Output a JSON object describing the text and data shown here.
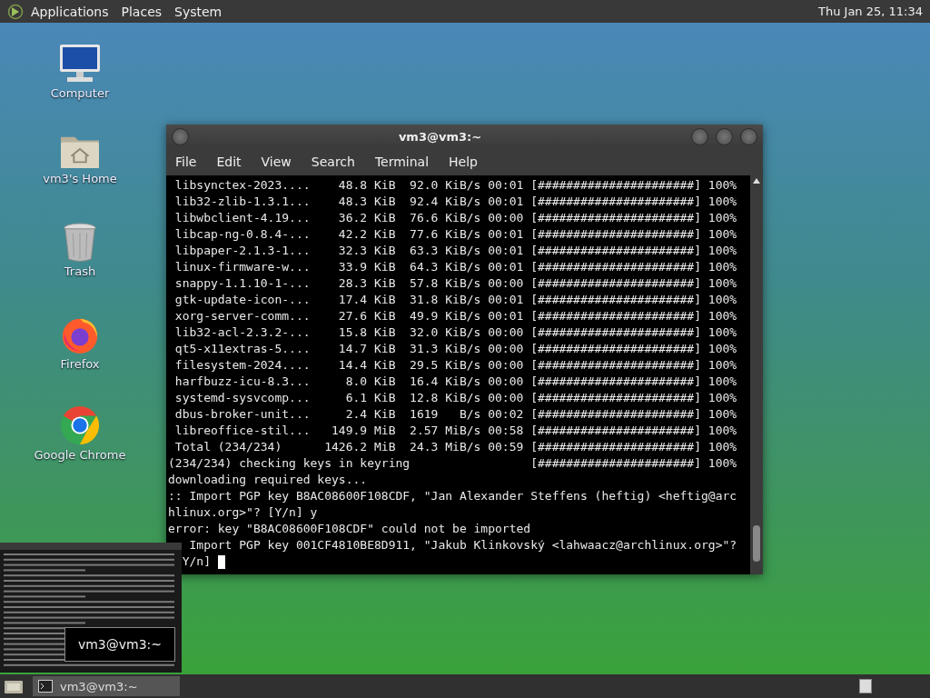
{
  "top_panel": {
    "menus": [
      "Applications",
      "Places",
      "System"
    ],
    "clock": "Thu Jan 25, 11:34"
  },
  "desktop_icons": [
    {
      "label": "Computer",
      "kind": "computer"
    },
    {
      "label": "vm3's Home",
      "kind": "home"
    },
    {
      "label": "Trash",
      "kind": "trash"
    },
    {
      "label": "Firefox",
      "kind": "firefox"
    },
    {
      "label": "Google Chrome",
      "kind": "chrome"
    }
  ],
  "terminal": {
    "title": "vm3@vm3:~",
    "menu": [
      "File",
      "Edit",
      "View",
      "Search",
      "Terminal",
      "Help"
    ],
    "lines": [
      " libsynctex-2023....    48.8 KiB  92.0 KiB/s 00:01 [######################] 100%",
      " lib32-zlib-1.3.1...    48.3 KiB  92.4 KiB/s 00:01 [######################] 100%",
      " libwbclient-4.19...    36.2 KiB  76.6 KiB/s 00:00 [######################] 100%",
      " libcap-ng-0.8.4-...    42.2 KiB  77.6 KiB/s 00:01 [######################] 100%",
      " libpaper-2.1.3-1...    32.3 KiB  63.3 KiB/s 00:01 [######################] 100%",
      " linux-firmware-w...    33.9 KiB  64.3 KiB/s 00:01 [######################] 100%",
      " snappy-1.1.10-1-...    28.3 KiB  57.8 KiB/s 00:00 [######################] 100%",
      " gtk-update-icon-...    17.4 KiB  31.8 KiB/s 00:01 [######################] 100%",
      " xorg-server-comm...    27.6 KiB  49.9 KiB/s 00:01 [######################] 100%",
      " lib32-acl-2.3.2-...    15.8 KiB  32.0 KiB/s 00:00 [######################] 100%",
      " qt5-x11extras-5....    14.7 KiB  31.3 KiB/s 00:00 [######################] 100%",
      " filesystem-2024....    14.4 KiB  29.5 KiB/s 00:00 [######################] 100%",
      " harfbuzz-icu-8.3...     8.0 KiB  16.4 KiB/s 00:00 [######################] 100%",
      " systemd-sysvcomp...     6.1 KiB  12.8 KiB/s 00:00 [######################] 100%",
      " dbus-broker-unit...     2.4 KiB  1619   B/s 00:02 [######################] 100%",
      " libreoffice-stil...   149.9 MiB  2.57 MiB/s 00:58 [######################] 100%",
      " Total (234/234)      1426.2 MiB  24.3 MiB/s 00:59 [######################] 100%",
      "(234/234) checking keys in keyring                 [######################] 100%",
      "downloading required keys...",
      ":: Import PGP key B8AC08600F108CDF, \"Jan Alexander Steffens (heftig) <heftig@arc",
      "hlinux.org>\"? [Y/n] y",
      "error: key \"B8AC08600F108CDF\" could not be imported",
      "   Import PGP key 001CF4810BE8D911, \"Jakub Klinkovský <lahwaacz@archlinux.org>\"?",
      "  Y/n]"
    ]
  },
  "window_preview": {
    "label": "vm3@vm3:~"
  },
  "taskbar": {
    "tasks": [
      {
        "label": "vm3@vm3:~",
        "selected": true
      }
    ]
  }
}
